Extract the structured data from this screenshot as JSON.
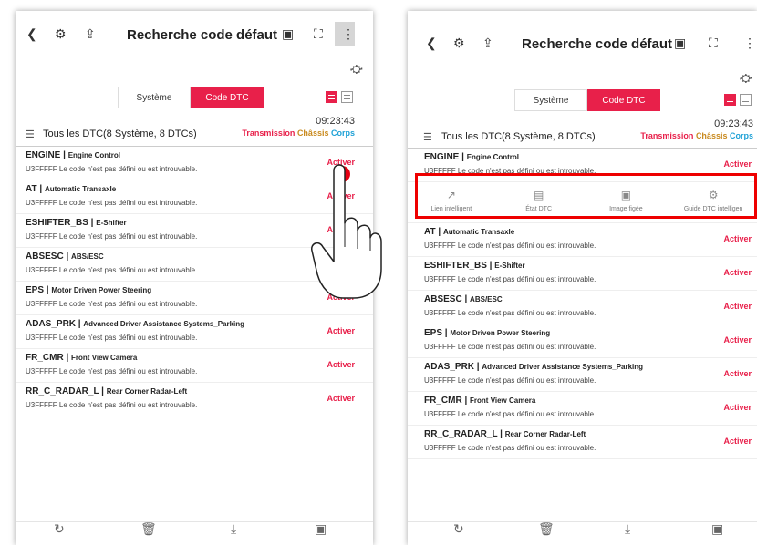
{
  "common": {
    "title": "Recherche code défaut",
    "tab_system": "Système",
    "tab_dtc": "Code DTC",
    "time": "09:23:43",
    "summary": "Tous les DTC(8 Système, 8 DTCs)",
    "filter_transmission": "Transmission",
    "filter_chassis": "Châssis",
    "filter_corps": "Corps",
    "action_label": "Activer"
  },
  "dtcs": [
    {
      "code": "ENGINE",
      "desc": "Engine Control",
      "msg": "U3FFFFF Le code n'est pas défini ou est introuvable."
    },
    {
      "code": "AT",
      "desc": "Automatic Transaxle",
      "msg": "U3FFFFF Le code n'est pas défini ou est introuvable."
    },
    {
      "code": "ESHIFTER_BS",
      "desc": "E-Shifter",
      "msg": "U3FFFFF Le code n'est pas défini ou est introuvable."
    },
    {
      "code": "ABSESC",
      "desc": "ABS/ESC",
      "msg": "U3FFFFF Le code n'est pas défini ou est introuvable."
    },
    {
      "code": "EPS",
      "desc": "Motor Driven Power Steering",
      "msg": "U3FFFFF Le code n'est pas défini ou est introuvable."
    },
    {
      "code": "ADAS_PRK",
      "desc": "Advanced Driver Assistance Systems_Parking",
      "msg": "U3FFFFF Le code n'est pas défini ou est introuvable."
    },
    {
      "code": "FR_CMR",
      "desc": "Front View Camera",
      "msg": "U3FFFFF Le code n'est pas défini ou est introuvable."
    },
    {
      "code": "RR_C_RADAR_L",
      "desc": "Rear Corner Radar-Left",
      "msg": "U3FFFFF Le code n'est pas défini ou est introuvable."
    }
  ],
  "action_bar": {
    "smart_link": "Lien intelligent",
    "dtc_status": "État DTC",
    "freeze_frame": "Image figée",
    "smart_guide": "Guide DTC intelligen"
  },
  "icons": {
    "back": "chevron-left-icon",
    "vci": "vci-icon",
    "export": "export-icon",
    "vci_status": "vci-status-icon",
    "fullscreen": "fullscreen-icon",
    "menu": "more-vertical-icon",
    "car": "car-icon",
    "refresh": "refresh-icon",
    "delete": "trash-icon",
    "download": "download-icon",
    "save": "save-icon"
  },
  "colors": {
    "accent": "#e8204a",
    "chassis": "#c98a1e",
    "corps": "#1ea1d6",
    "highlight": "#e00000"
  }
}
